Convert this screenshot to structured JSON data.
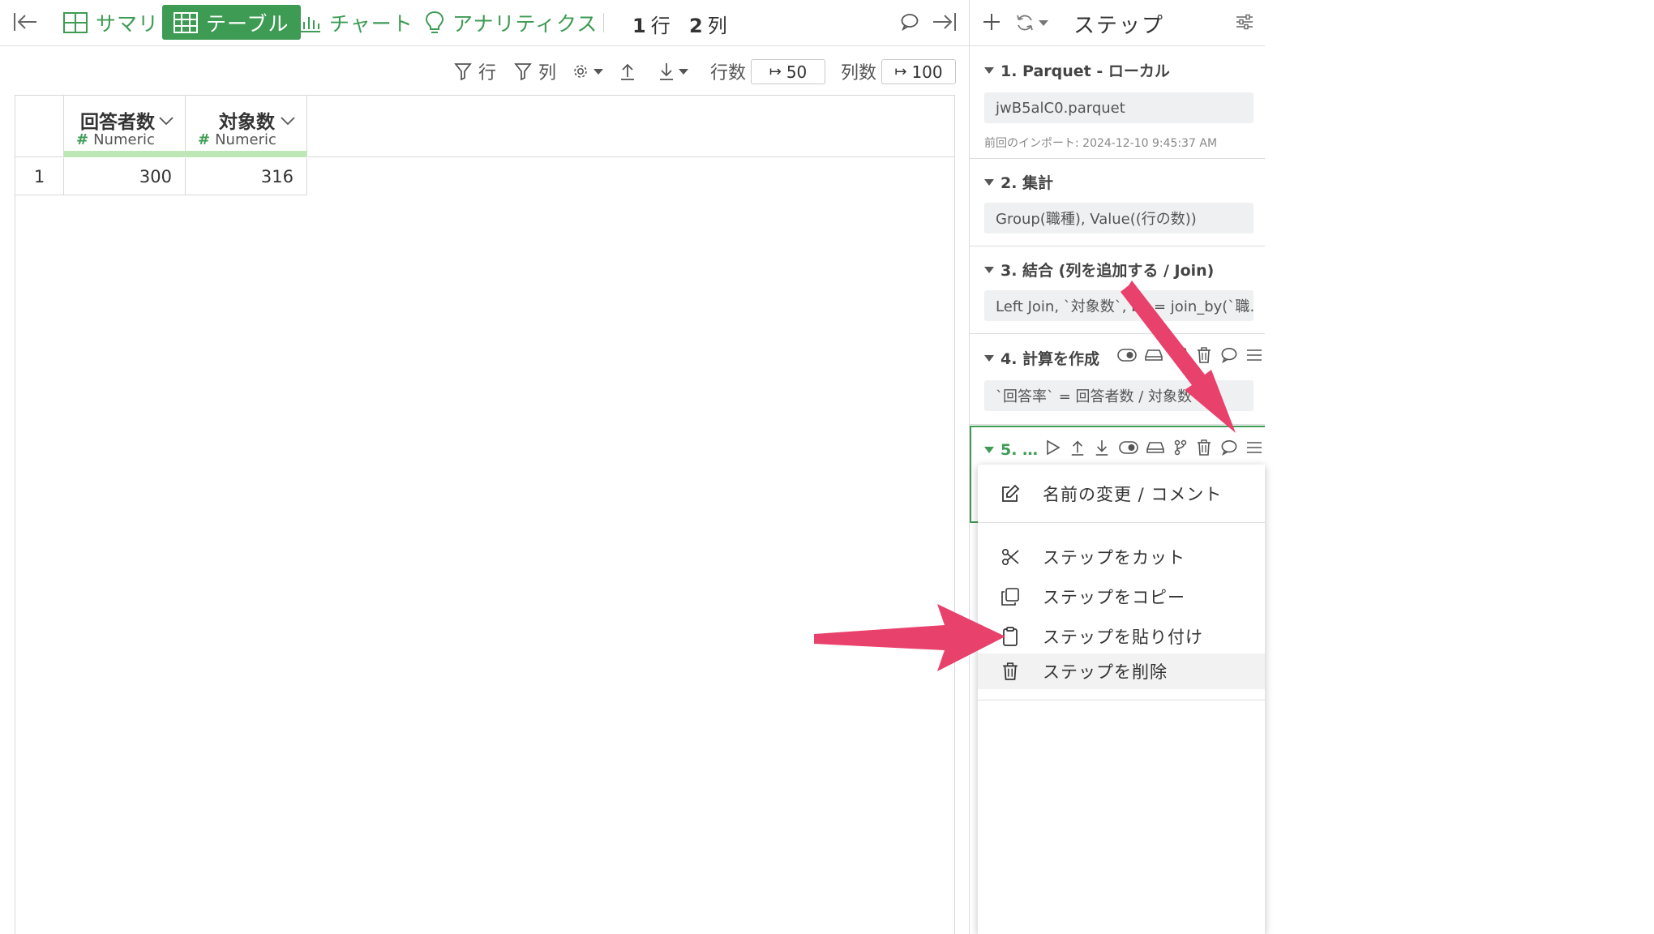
{
  "toolbar": {
    "tabs": [
      {
        "label": "サマリ"
      },
      {
        "label": "テーブル"
      },
      {
        "label": "チャート"
      },
      {
        "label": "アナリティクス"
      }
    ],
    "row_count": "1",
    "row_unit": "行",
    "col_count": "2",
    "col_unit": "列"
  },
  "subtoolbar": {
    "row_filter": "行",
    "col_filter": "列",
    "rows_label": "行数",
    "rows_value": "50",
    "cols_label": "列数",
    "cols_value": "100"
  },
  "table": {
    "columns": [
      {
        "name": "回答者数",
        "type": "Numeric"
      },
      {
        "name": "対象数",
        "type": "Numeric"
      }
    ],
    "rows": [
      {
        "index": "1",
        "cells": [
          "300",
          "316"
        ]
      }
    ]
  },
  "steps_panel": {
    "title": "ステップ",
    "steps": [
      {
        "title": "1. Parquet - ローカル",
        "body": "jwB5alC0.parquet",
        "meta": "前回のインポート: 2024-12-10 9:45:37 AM"
      },
      {
        "title": "2. 集計",
        "body": "Group(職種), Value((行の数))"
      },
      {
        "title": "3. 結合 (列を追加する / Join)",
        "body": "Left Join, `対象数`, by = join_by(`職…"
      },
      {
        "title": "4. 計算を作成",
        "body": "`回答率` = 回答者数 / 対象数"
      },
      {
        "title": "5. …"
      }
    ]
  },
  "context_menu": {
    "items": [
      {
        "label": "名前の変更 / コメント",
        "icon": "edit-icon"
      },
      {
        "label": "ステップをカット",
        "icon": "scissors-icon"
      },
      {
        "label": "ステップをコピー",
        "icon": "copy-icon"
      },
      {
        "label": "ステップを貼り付け",
        "icon": "clipboard-icon"
      },
      {
        "label": "ステップを削除",
        "icon": "trash-icon"
      }
    ]
  },
  "colors": {
    "accent": "#3d9b53",
    "annotation_arrow": "#e8416b",
    "type_bar": "#bde8b5"
  }
}
